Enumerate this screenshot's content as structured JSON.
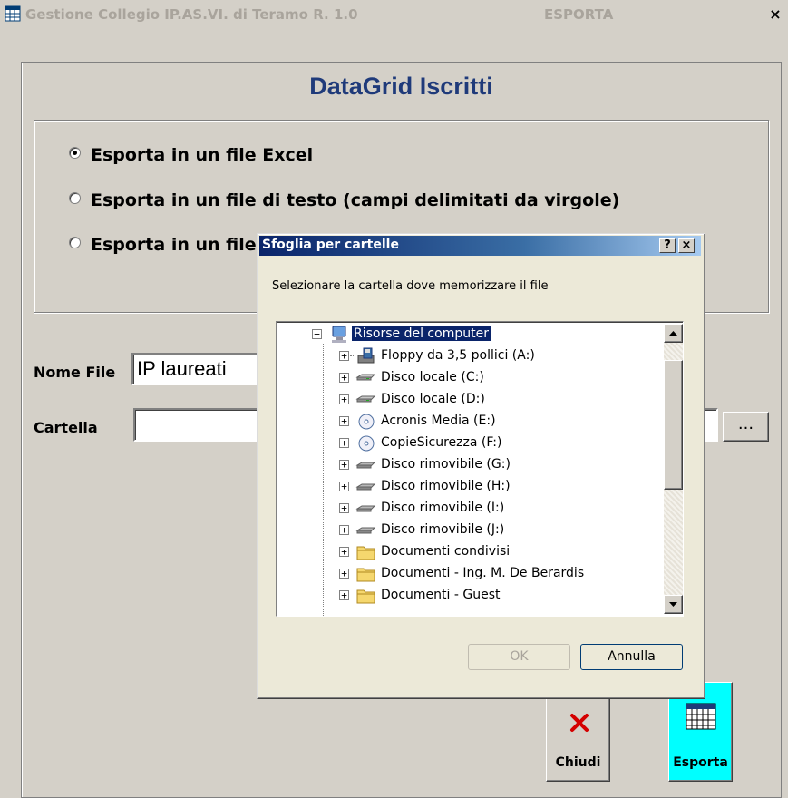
{
  "window": {
    "title": "Gestione Collegio IP.AS.VI. di Teramo R. 1.0",
    "subtitle": "ESPORTA",
    "close_label": "×"
  },
  "page": {
    "heading": "DataGrid Iscritti"
  },
  "options": [
    {
      "label": "Esporta in un file Excel",
      "selected": true
    },
    {
      "label": "Esporta in un file di testo (campi delimitati da virgole)",
      "selected": false
    },
    {
      "label": "Esporta in un file",
      "selected": false
    }
  ],
  "fields": {
    "nome_file_label": "Nome File",
    "nome_file_value": "IP laureati",
    "cartella_label": "Cartella",
    "cartella_value": "",
    "browse_label": "..."
  },
  "buttons": {
    "chiudi": "Chiudi",
    "esporta": "Esporta"
  },
  "dialog": {
    "title": "Sfoglia per cartelle",
    "help_label": "?",
    "close_label": "×",
    "instruction": "Selezionare  la cartella dove memorizzare il file",
    "root": "Risorse del computer",
    "items": [
      {
        "label": "Floppy da 3,5 pollici (A:)",
        "icon": "floppy-icon"
      },
      {
        "label": "Disco locale (C:)",
        "icon": "hard-drive-icon"
      },
      {
        "label": "Disco locale (D:)",
        "icon": "hard-drive-icon"
      },
      {
        "label": "Acronis Media (E:)",
        "icon": "cd-drive-icon"
      },
      {
        "label": "CopieSicurezza (F:)",
        "icon": "cd-drive-icon"
      },
      {
        "label": "Disco rimovibile (G:)",
        "icon": "removable-drive-icon"
      },
      {
        "label": "Disco rimovibile (H:)",
        "icon": "removable-drive-icon"
      },
      {
        "label": "Disco rimovibile (I:)",
        "icon": "removable-drive-icon"
      },
      {
        "label": "Disco rimovibile (J:)",
        "icon": "removable-drive-icon"
      },
      {
        "label": "Documenti condivisi",
        "icon": "folder-icon"
      },
      {
        "label": "Documenti - Ing. M. De Berardis",
        "icon": "folder-icon"
      },
      {
        "label": "Documenti - Guest",
        "icon": "folder-icon"
      }
    ],
    "ok_label": "OK",
    "cancel_label": "Annulla"
  },
  "colors": {
    "selection": "#0a246a",
    "heading": "#1f3a7a",
    "esporta_bg": "#00ffff",
    "chiudi_icon": "#d40000"
  }
}
